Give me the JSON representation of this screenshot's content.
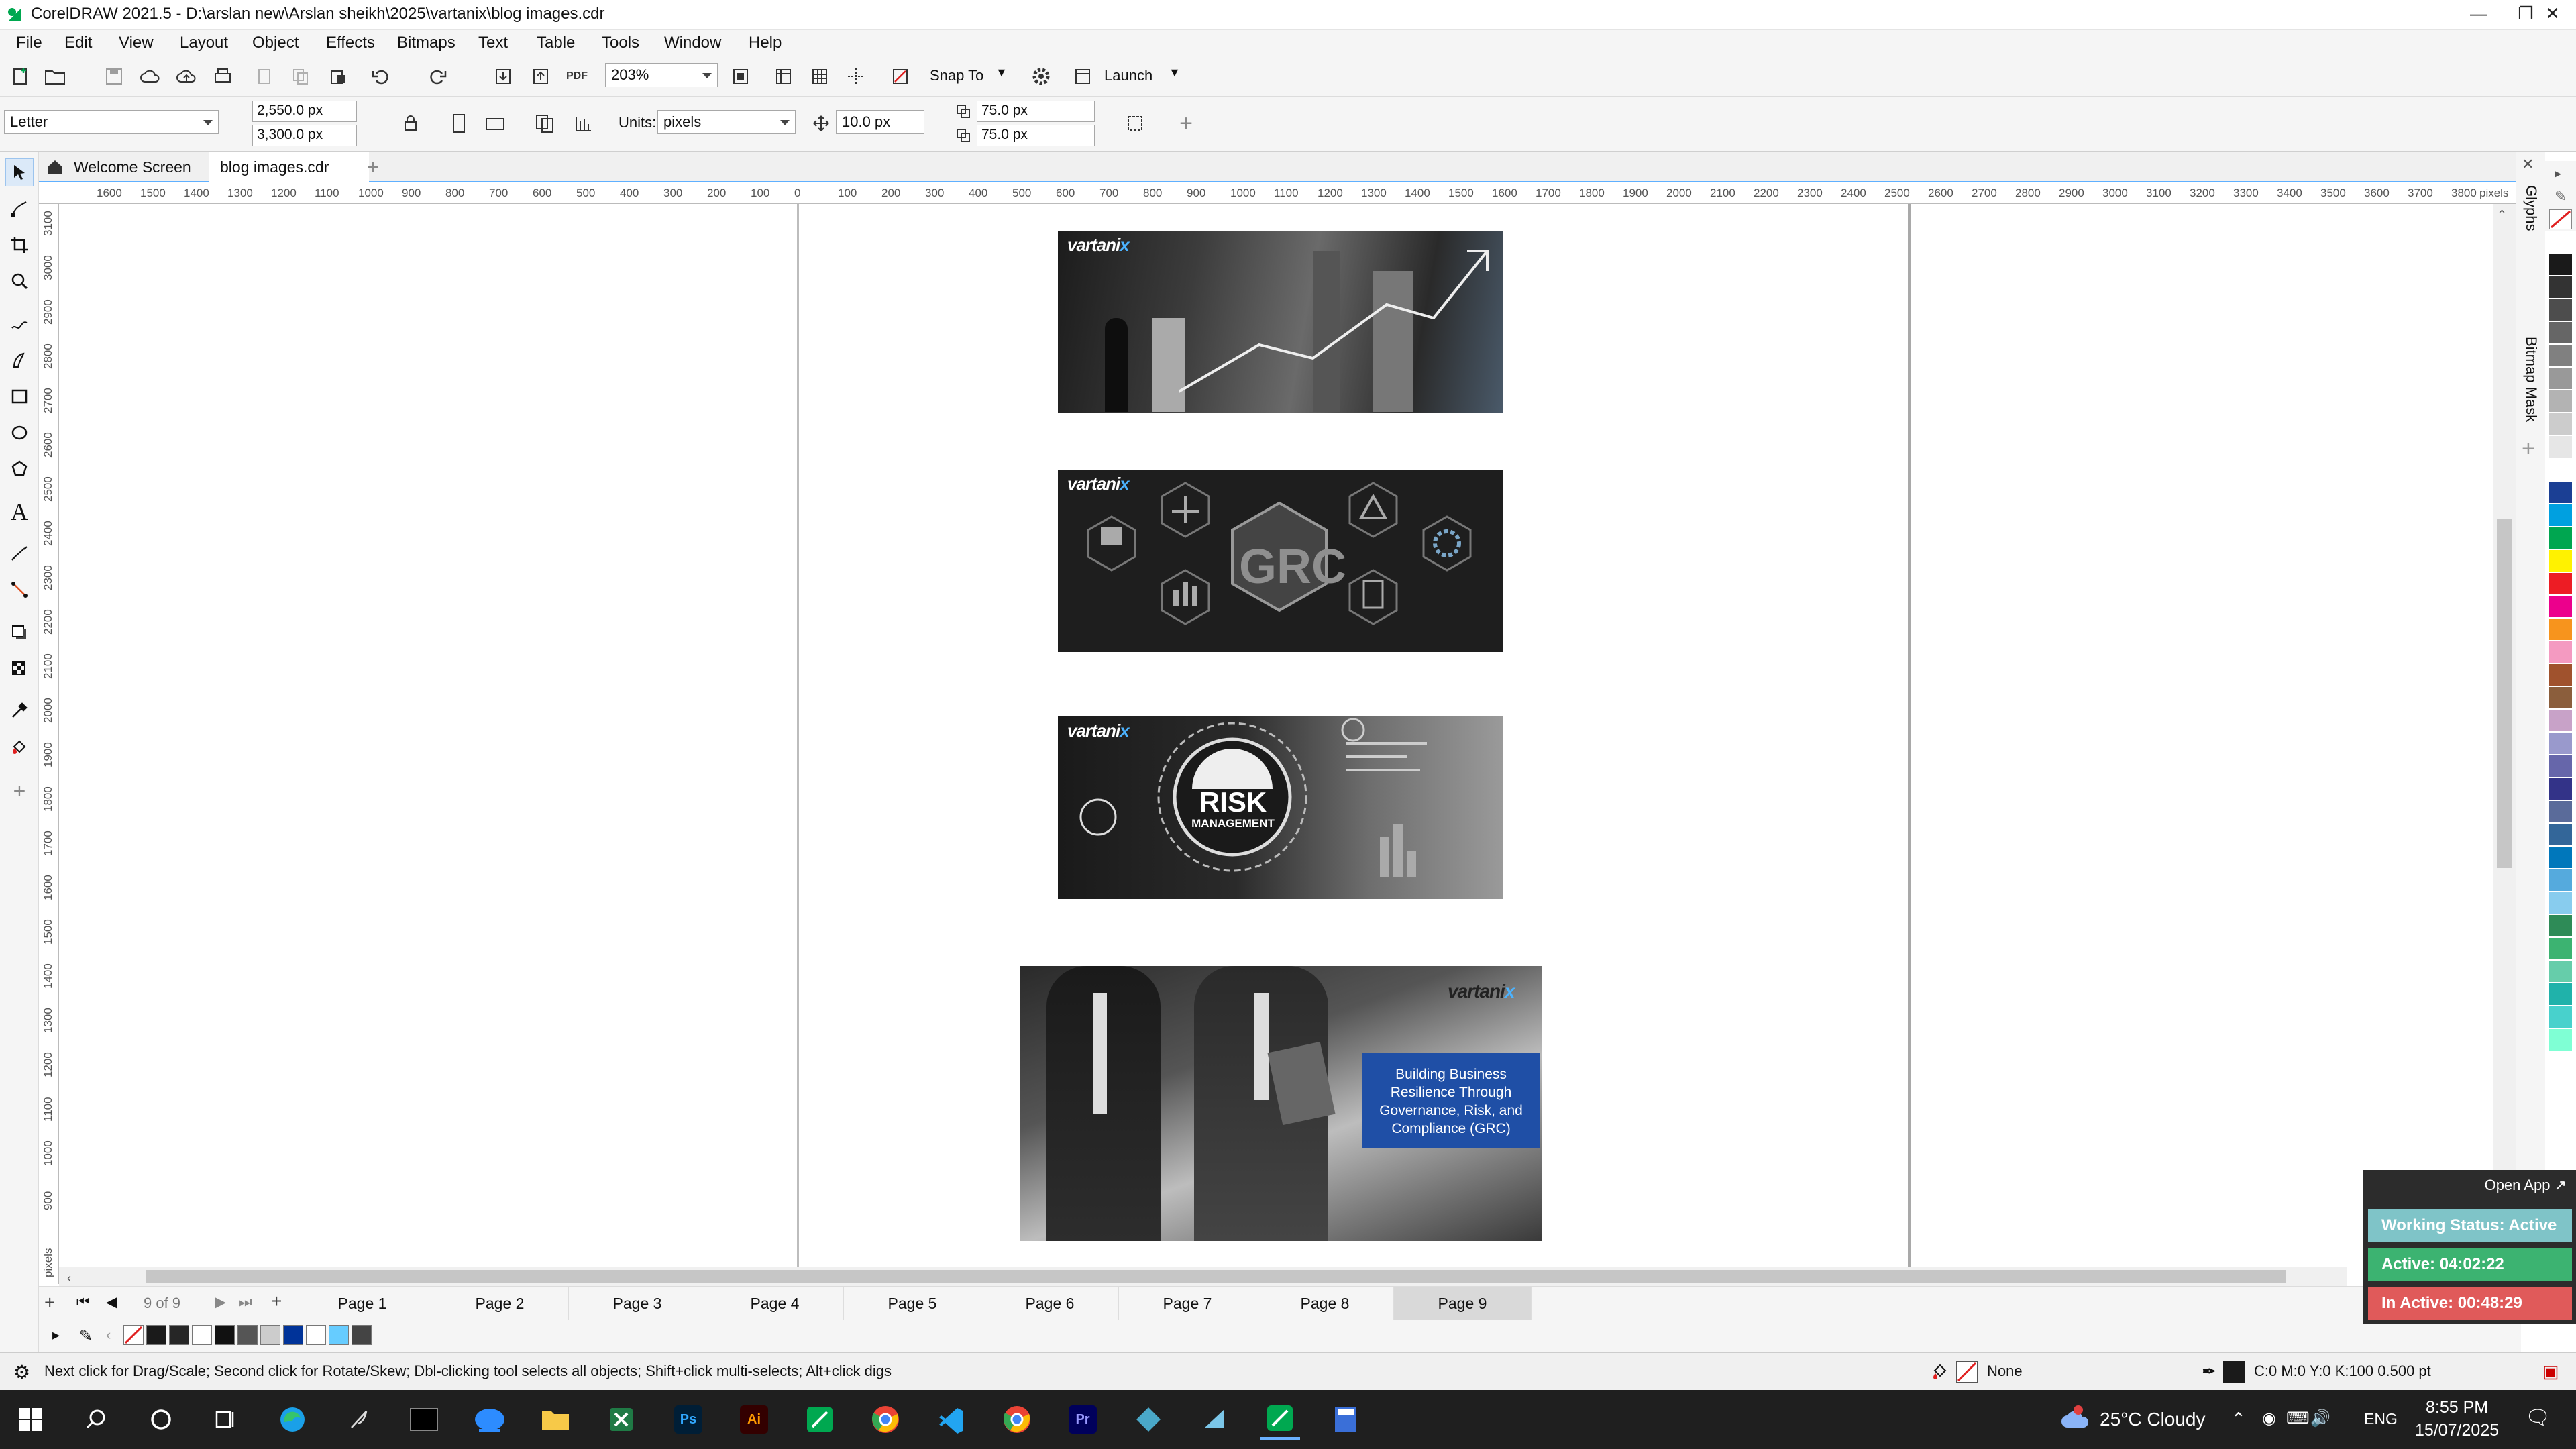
{
  "app": {
    "title": "CorelDRAW 2021.5 - D:\\arslan new\\Arslan sheikh\\2025\\vartanix\\blog images.cdr",
    "brand_color": "#00a850"
  },
  "menu": [
    "File",
    "Edit",
    "View",
    "Layout",
    "Object",
    "Effects",
    "Bitmaps",
    "Text",
    "Table",
    "Tools",
    "Window",
    "Help"
  ],
  "toolbar": {
    "zoom": "203%",
    "snap_to": "Snap To",
    "launch": "Launch"
  },
  "property_bar": {
    "page_size": "Letter",
    "width": "2,550.0 px",
    "height": "3,300.0 px",
    "units_label": "Units:",
    "units": "pixels",
    "nudge": "10.0 px",
    "dup_x": "75.0 px",
    "dup_y": "75.0 px"
  },
  "tabs": {
    "welcome": "Welcome Screen",
    "doc": "blog images.cdr"
  },
  "rulers": {
    "h_ticks": [
      "1600",
      "1500",
      "1400",
      "1300",
      "1200",
      "1100",
      "1000",
      "900",
      "800",
      "700",
      "600",
      "500",
      "400",
      "300",
      "200",
      "100",
      "0",
      "100",
      "200",
      "300",
      "400",
      "500",
      "600",
      "700",
      "800",
      "900",
      "1000",
      "1100",
      "1200",
      "1300",
      "1400",
      "1500",
      "1600",
      "1700",
      "1800",
      "1900",
      "2000",
      "2100",
      "2200",
      "2300",
      "2400",
      "2500",
      "2600",
      "2700",
      "2800",
      "2900",
      "3000",
      "3100",
      "3200",
      "3300",
      "3400",
      "3500",
      "3600",
      "3700",
      "3800"
    ],
    "h_unit": "pixels",
    "v_ticks": [
      "3100",
      "3000",
      "2900",
      "2800",
      "2700",
      "2600",
      "2500",
      "2400",
      "2300",
      "2200",
      "2100",
      "2000",
      "1900",
      "1800",
      "1700",
      "1600",
      "1500",
      "1400",
      "1300",
      "1200",
      "1100",
      "1000",
      "900"
    ],
    "v_unit": "pixels"
  },
  "canvas": {
    "brand_word": "vartani",
    "brand_x": "x",
    "image2_text": "GRC",
    "image3_text1": "RISK",
    "image3_text2": "MANAGEMENT",
    "image4_caption": "Building Business Resilience Through Governance, Risk, and Compliance (GRC)"
  },
  "page_nav": {
    "counter": "9 of 9",
    "pages": [
      "Page 1",
      "Page 2",
      "Page 3",
      "Page 4",
      "Page 5",
      "Page 6",
      "Page 7",
      "Page 8",
      "Page 9"
    ],
    "active": "Page 9"
  },
  "doc_palette": [
    "#ffffff",
    "#1a1a1a",
    "#262626",
    "#ffffff",
    "#111111",
    "#555555",
    "#cccccc",
    "#003399",
    "#ffffff",
    "#66ccff",
    "#444444"
  ],
  "status": {
    "hint": "Next click for Drag/Scale; Second click for Rotate/Skew; Dbl-clicking tool selects all objects; Shift+click multi-selects; Alt+click digs",
    "fill": "None",
    "outline": "C:0 M:0 Y:0 K:100  0.500 pt"
  },
  "right_dock": {
    "glyphs": "Glyphs",
    "bitmap_mask": "Bitmap Mask"
  },
  "palette": [
    "#ffffff",
    "#1a1a1a",
    "#333333",
    "#4d4d4d",
    "#666666",
    "#808080",
    "#999999",
    "#b3b3b3",
    "#cccccc",
    "#e6e6e6",
    "#ffffff",
    "#1b3f94",
    "#00a0e0",
    "#00a650",
    "#fff200",
    "#ed1c24",
    "#ec008c",
    "#f7941d",
    "#f49ac1",
    "#a0522d",
    "#8b5e3c",
    "#c8a2c8",
    "#9999cc",
    "#6666aa",
    "#333388",
    "#5a6b9a",
    "#336699",
    "#0077bb",
    "#55aadd",
    "#88ccee",
    "#2e8b57",
    "#3cb371",
    "#66cdaa",
    "#20b2aa",
    "#48d1cc",
    "#7fffd4"
  ],
  "tracker": {
    "open_app": "Open App ↗",
    "working": "Working Status: Active",
    "active": "Active: 04:02:22",
    "inactive": "In Active: 00:48:29",
    "working_color": "#7fc4c8",
    "active_color": "#3cb371",
    "inactive_color": "#e05a5a"
  },
  "taskbar": {
    "weather": "25°C  Cloudy",
    "lang": "ENG",
    "time": "8:55 PM",
    "date": "15/07/2025"
  }
}
